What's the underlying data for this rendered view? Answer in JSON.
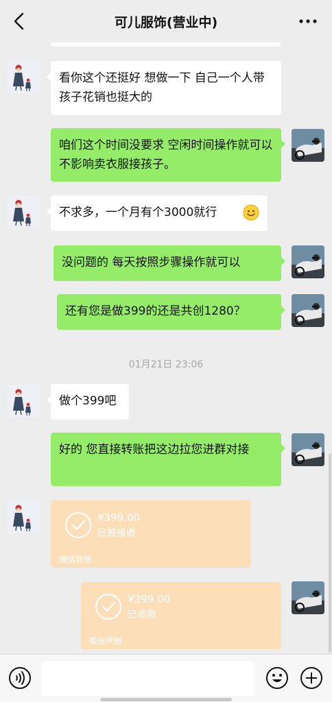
{
  "header": {
    "title": "可儿服饰(营业中)"
  },
  "messages": {
    "m1": {
      "text": "看你这个还挺好 想做一下  自己一个人带孩子花销也挺大的"
    },
    "m2": {
      "text": "咱们这个时间没要求 空闲时间操作就可以 不影响卖衣服接孩子。"
    },
    "m3": {
      "text": "不求多，一个月有个3000就行"
    },
    "m4": {
      "text": "没问题的 每天按照步骤操作就可以"
    },
    "m5": {
      "text": "还有您是做399的还是共创1280？"
    },
    "m6": {
      "text": "做个399吧"
    },
    "m7": {
      "text": "好的 您直接转账把这边拉您进群对接"
    }
  },
  "timestamp": "01月21日 23:06",
  "transfers": {
    "t1": {
      "amount": "¥399.00",
      "status": "已被接收",
      "label": "微信转账"
    },
    "t2": {
      "amount": "¥399.00",
      "status": "已收款",
      "label": "微信转账"
    }
  },
  "icons": {
    "back": "chevron-left-icon",
    "more": "ellipsis-icon",
    "voice": "voice-icon",
    "emoji": "emoji-icon",
    "plus": "plus-icon"
  },
  "colors": {
    "background": "#ededed",
    "outgoing_bubble": "#95ec69",
    "incoming_bubble": "#ffffff",
    "transfer_card": "#fcdfb9"
  }
}
